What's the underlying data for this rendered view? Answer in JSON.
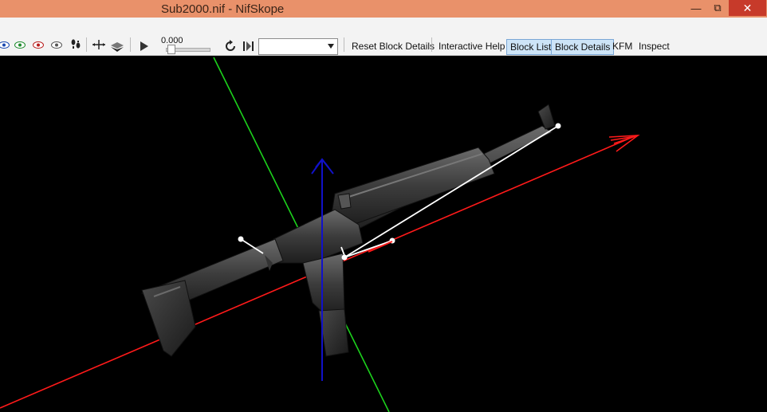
{
  "window": {
    "title": "Sub2000.nif - NifSkope",
    "min_icon": "minimize-icon",
    "max_icon": "restore-icon",
    "close_icon": "close-icon"
  },
  "toolbar": {
    "time_value": "0.000",
    "anim_select_value": "",
    "buttons": [
      {
        "label": "Reset Block Details",
        "pressed": false
      },
      {
        "label": "Interactive Help",
        "pressed": false
      },
      {
        "label": "Block List",
        "pressed": true
      },
      {
        "label": "Block Details",
        "pressed": true
      },
      {
        "label": "KFM",
        "pressed": false
      },
      {
        "label": "Inspect",
        "pressed": false
      }
    ],
    "icons": [
      "view-eye-blue-icon",
      "view-eye-green-icon",
      "view-eye-red-icon",
      "view-eye-gray-icon",
      "footprints-icon",
      "move-axis-icon",
      "view-mode-icon",
      "play-icon",
      "loop-icon",
      "frame-step-icon",
      "dropdown-arrow-icon"
    ]
  },
  "viewport": {
    "axis_colors": {
      "x": "#ff1a1a",
      "y": "#1cd21c",
      "z": "#1111c8"
    },
    "background": "#000000"
  }
}
